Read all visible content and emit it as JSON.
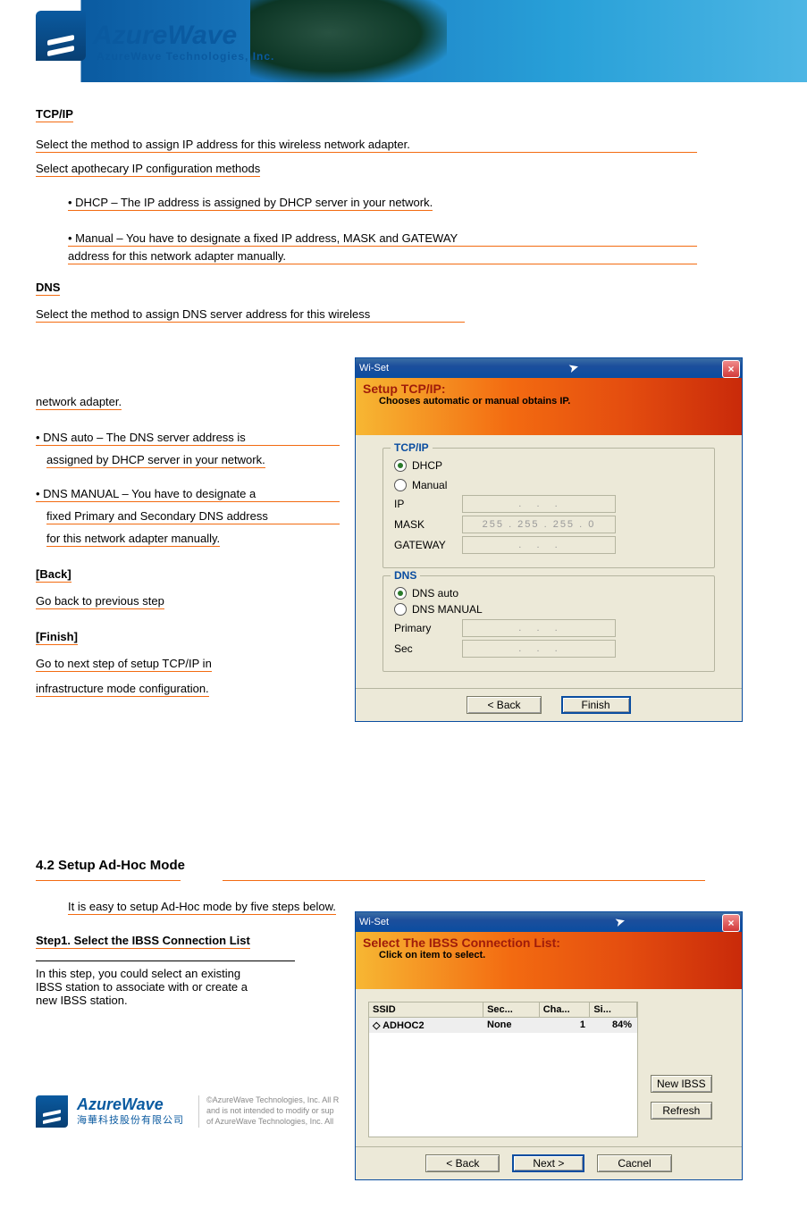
{
  "banner": {
    "brand": "AzureWave",
    "tagline": "AzureWave Technologies, Inc."
  },
  "body": {
    "tcpip_heading": "TCP/IP",
    "tcpip_desc": "Select the method to assign IP address for this wireless network adapter.",
    "tcpip_opts_intro": "Select apothecary IP configuration methods",
    "tcpip_item_dhcp": "DHCP – The IP address is assigned by DHCP server in your network.",
    "tcpip_item_manual1": "Manual – You have to designate a fixed IP address, MASK and GATEWAY",
    "tcpip_item_manual2": "address for this network adapter manually.",
    "dns_heading": "DNS",
    "dns_desc": "Select the method to assign DNS server address for this wireless",
    "dns_adapter": "network adapter.",
    "dns_item_auto1": "DNS auto – The DNS server address is",
    "dns_item_auto2": "assigned by DHCP server in your network.",
    "dns_item_manual1": "DNS MANUAL – You have to designate a",
    "dns_item_manual2": "fixed Primary and Secondary DNS address",
    "dns_item_manual3": "for this network adapter manually.",
    "back_heading": "[Back]",
    "back_desc": "Go back to previous step",
    "finish_heading": "[Finish]",
    "finish_desc1": "Go to next step of setup TCP/IP in",
    "finish_desc2": "infrastructure mode configuration.",
    "section42": "4.2 Setup Ad-Hoc Mode",
    "section42_desc": "It is easy to setup Ad-Hoc mode by five steps below.",
    "step1": "Step1. Select the IBSS Connection List",
    "step1_desc1": "In this step, you could select an existing",
    "step1_desc2": "IBSS station to associate with or create a",
    "step1_desc3": "new IBSS station."
  },
  "dlg1": {
    "title": "Wi-Set",
    "hdr_title": "Setup TCP/IP:",
    "hdr_sub": "Chooses automatic or manual obtains IP.",
    "grp_tcpip": "TCP/IP",
    "opt_dhcp": "DHCP",
    "opt_manual": "Manual",
    "lbl_ip": "IP",
    "lbl_mask": "MASK",
    "mask_val": "255 . 255 . 255 . 0",
    "lbl_gateway": "GATEWAY",
    "grp_dns": "DNS",
    "opt_dns_auto": "DNS auto",
    "opt_dns_manual": "DNS MANUAL",
    "lbl_primary": "Primary",
    "lbl_sec": "Sec",
    "btn_back": "< Back",
    "btn_finish": "Finish"
  },
  "dlg2": {
    "title": "Wi-Set",
    "hdr_title": "Select The IBSS Connection List:",
    "hdr_sub": "Click on item to select.",
    "col_ssid": "SSID",
    "col_sec": "Sec...",
    "col_cha": "Cha...",
    "col_si": "Si...",
    "row_ssid": "ADHOC2",
    "row_sec": "None",
    "row_cha": "1",
    "row_si": "84%",
    "btn_new": "New IBSS",
    "btn_refresh": "Refresh",
    "btn_back": "< Back",
    "btn_next": "Next >",
    "btn_cancel": "Cacnel"
  },
  "footer": {
    "brand": "AzureWave",
    "cn": "海華科技股份有限公司",
    "copy1": "©AzureWave Technologies, Inc. All R",
    "copy2": "and is not intended to modify or sup",
    "copy3": "of AzureWave Technologies, Inc. All"
  }
}
